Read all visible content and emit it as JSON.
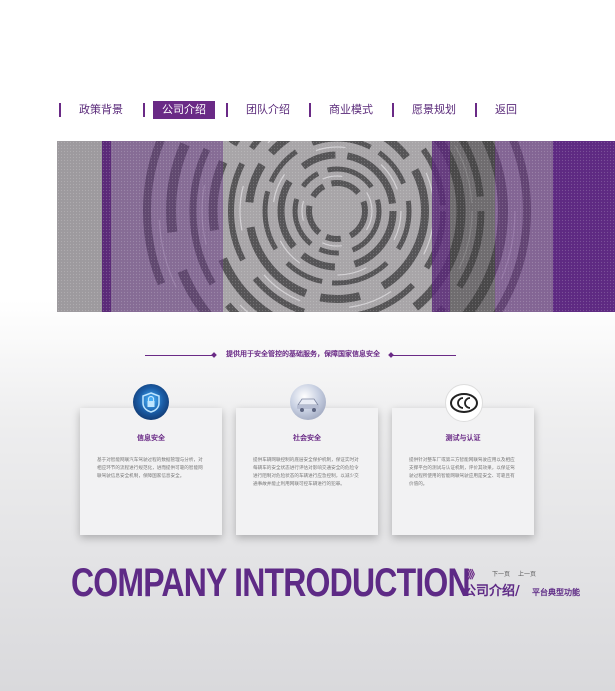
{
  "nav": {
    "items": [
      {
        "label": "政策背景",
        "active": false
      },
      {
        "label": "公司介绍",
        "active": true
      },
      {
        "label": "团队介绍",
        "active": false
      },
      {
        "label": "商业模式",
        "active": false
      },
      {
        "label": "愿景规划",
        "active": false
      },
      {
        "label": "返回",
        "active": false
      }
    ]
  },
  "tagline": "提供用于安全管控的基础服务，保障国家信息安全",
  "cards": [
    {
      "icon": "shield-lock-icon",
      "title": "信息安全",
      "desc": "基于对智能网联汽车驾驶过程的数据管理与分析，对相应环节的流程进行规范化，进而提供可靠的智能网联驾驶信息安全机制，保障国家信息安全。"
    },
    {
      "icon": "vehicle-icon",
      "title": "社会安全",
      "desc": "提供车辆网联控制的底层安全保护机制，保证实时对每辆车的安全状态进行评估对影响交通安全的危险令进行阻制对危险状态的车辆进行应急控制，以减少交通事故并能止利用网联可控车辆进行的犯罪。"
    },
    {
      "icon": "ccc-certification-icon",
      "title": "测试与认证",
      "desc": "提供针对整车厂或第三方智能网联驾驶应用以及相应支撑平台的测试与认证机制，评价其效果，以保证驾驶过程所使用的智能网联驾驶应用是安全、可靠且有价值的。"
    }
  ],
  "bottom": {
    "big_title": "COMPANY INTRODUCTION",
    "chevrons": "》》",
    "prev_label": "下一页",
    "next_label": "上一页",
    "cn_title": "公司介绍/",
    "cn_subtitle": "平台典型功能"
  },
  "colors": {
    "accent": "#6a2a86",
    "banner_gray": "#a7a4a7",
    "banner_dark": "#575657"
  }
}
